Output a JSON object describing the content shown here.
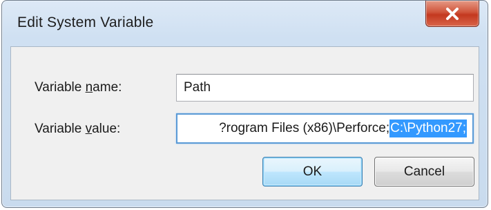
{
  "window": {
    "title": "Edit System Variable",
    "close_icon": "close-x-icon"
  },
  "form": {
    "name_label_pre": "Variable ",
    "name_label_u": "n",
    "name_label_post": "ame:",
    "name_value": "Path",
    "value_label_pre": "Variable ",
    "value_label_u": "v",
    "value_label_post": "alue:",
    "value_text_visible": "?rogram Files (x86)\\Perforce;",
    "value_text_selected": "C:\\Python27;"
  },
  "buttons": {
    "ok_label": "OK",
    "cancel_label": "Cancel"
  },
  "colors": {
    "selection": "#3399ff",
    "close_button": "#c3381f",
    "focus_border": "#5a9ad6"
  }
}
